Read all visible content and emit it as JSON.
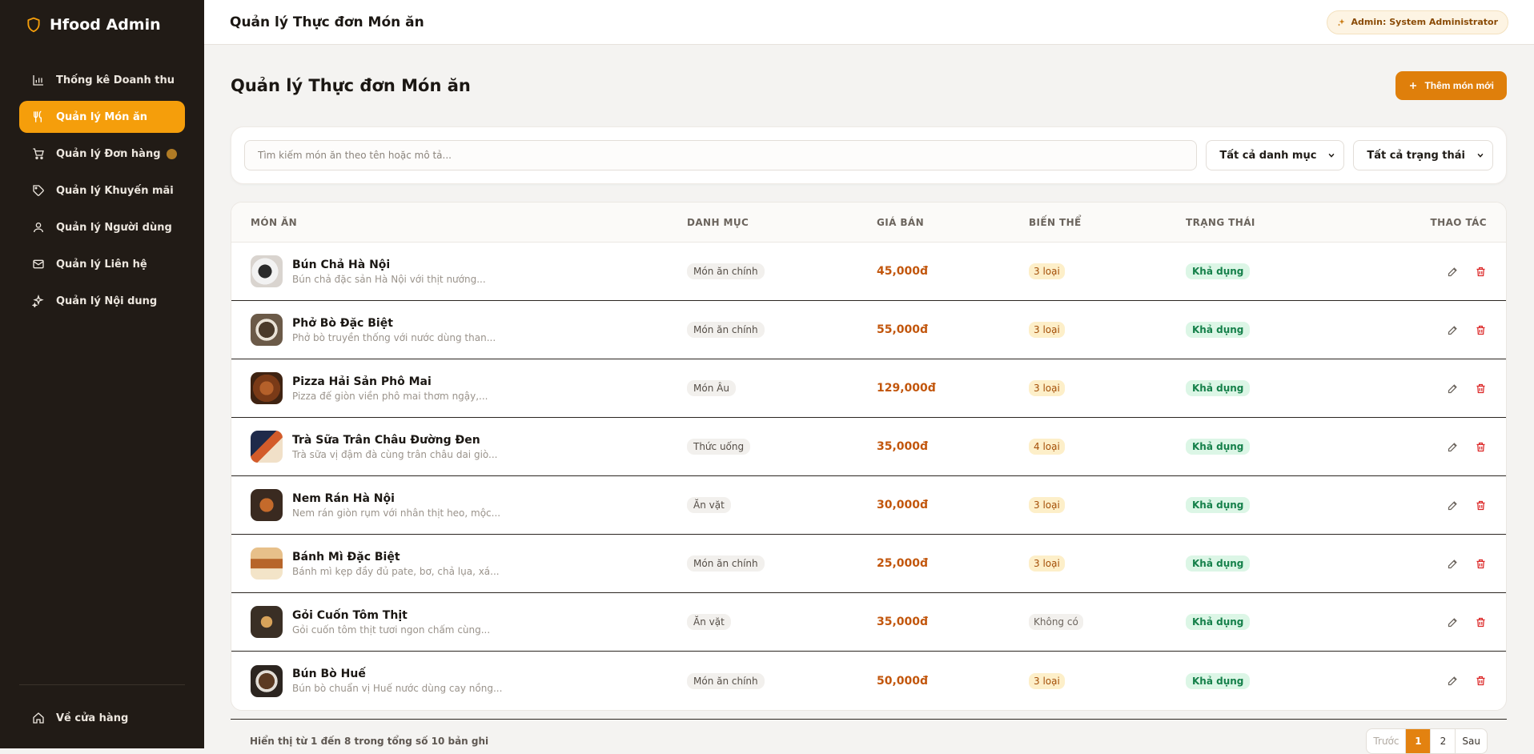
{
  "sidebar": {
    "brand": "Hfood Admin",
    "items": [
      {
        "label": "Thống kê Doanh thu",
        "icon": "bar-chart-icon"
      },
      {
        "label": "Quản lý Món ăn",
        "icon": "utensils-icon",
        "active": true
      },
      {
        "label": "Quản lý Đơn hàng",
        "icon": "cart-icon"
      },
      {
        "label": "Quản lý Khuyến mãi",
        "icon": "tag-icon"
      },
      {
        "label": "Quản lý Người dùng",
        "icon": "users-icon"
      },
      {
        "label": "Quản lý Liên hệ",
        "icon": "mail-icon"
      },
      {
        "label": "Quản lý Nội dung",
        "icon": "sparkles-icon"
      }
    ],
    "back_to_store": "Về cửa hàng"
  },
  "topbar": {
    "title": "Quản lý Thực đơn Món ăn",
    "admin_badge": "Admin: System Administrator"
  },
  "main": {
    "title": "Quản lý Thực đơn Món ăn",
    "add_button": "Thêm món mới"
  },
  "filters": {
    "search_placeholder": "Tìm kiếm món ăn theo tên hoặc mô tả...",
    "category_select": "Tất cả danh mục",
    "status_select": "Tất cả trạng thái"
  },
  "table": {
    "headers": [
      "MÓN ĂN",
      "DANH MỤC",
      "GIÁ BÁN",
      "BIẾN THỂ",
      "TRẠNG THÁI",
      "THAO TÁC"
    ],
    "rows": [
      {
        "name": "Bún Chả Hà Nội",
        "desc": "Bún chả đặc sản Hà Nội với thịt nướng...",
        "category": "Món ăn chính",
        "price": "45,000đ",
        "variants": "3 loại",
        "status": "Khả dụng"
      },
      {
        "name": "Phở Bò Đặc Biệt",
        "desc": "Phở bò truyền thống với nước dùng than...",
        "category": "Món ăn chính",
        "price": "55,000đ",
        "variants": "3 loại",
        "status": "Khả dụng"
      },
      {
        "name": "Pizza Hải Sản Phô Mai",
        "desc": "Pizza đế giòn viền phô mai thơm ngậy,...",
        "category": "Món Âu",
        "price": "129,000đ",
        "variants": "3 loại",
        "status": "Khả dụng"
      },
      {
        "name": "Trà Sữa Trân Châu Đường Đen",
        "desc": "Trà sữa vị đậm đà cùng trân châu dai giò...",
        "category": "Thức uống",
        "price": "35,000đ",
        "variants": "4 loại",
        "status": "Khả dụng"
      },
      {
        "name": "Nem Rán Hà Nội",
        "desc": "Nem rán giòn rụm với nhân thịt heo, mộc...",
        "category": "Ăn vặt",
        "price": "30,000đ",
        "variants": "3 loại",
        "status": "Khả dụng"
      },
      {
        "name": "Bánh Mì Đặc Biệt",
        "desc": "Bánh mì kẹp đầy đủ pate, bơ, chả lụa, xá...",
        "category": "Món ăn chính",
        "price": "25,000đ",
        "variants": "3 loại",
        "status": "Khả dụng"
      },
      {
        "name": "Gỏi Cuốn Tôm Thịt",
        "desc": "Gỏi cuốn tôm thịt tươi ngon chấm cùng...",
        "category": "Ăn vặt",
        "price": "35,000đ",
        "variants": "Không có",
        "status": "Khả dụng"
      },
      {
        "name": "Bún Bò Huế",
        "desc": "Bún bò chuẩn vị Huế nước dùng cay nồng...",
        "category": "Món ăn chính",
        "price": "50,000đ",
        "variants": "3 loại",
        "status": "Khả dụng"
      }
    ]
  },
  "pagination": {
    "summary": "Hiển thị từ 1 đến 8 trong tổng số 10 bản ghi",
    "prev": "Trước",
    "pages": [
      "1",
      "2"
    ],
    "next": "Sau",
    "current": "1"
  },
  "colors": {
    "sidebar_bg": "#211b16",
    "accent": "#f59e0b",
    "price": "#c2560c",
    "status_green": "#15804a",
    "delete_red": "#dc2626"
  }
}
